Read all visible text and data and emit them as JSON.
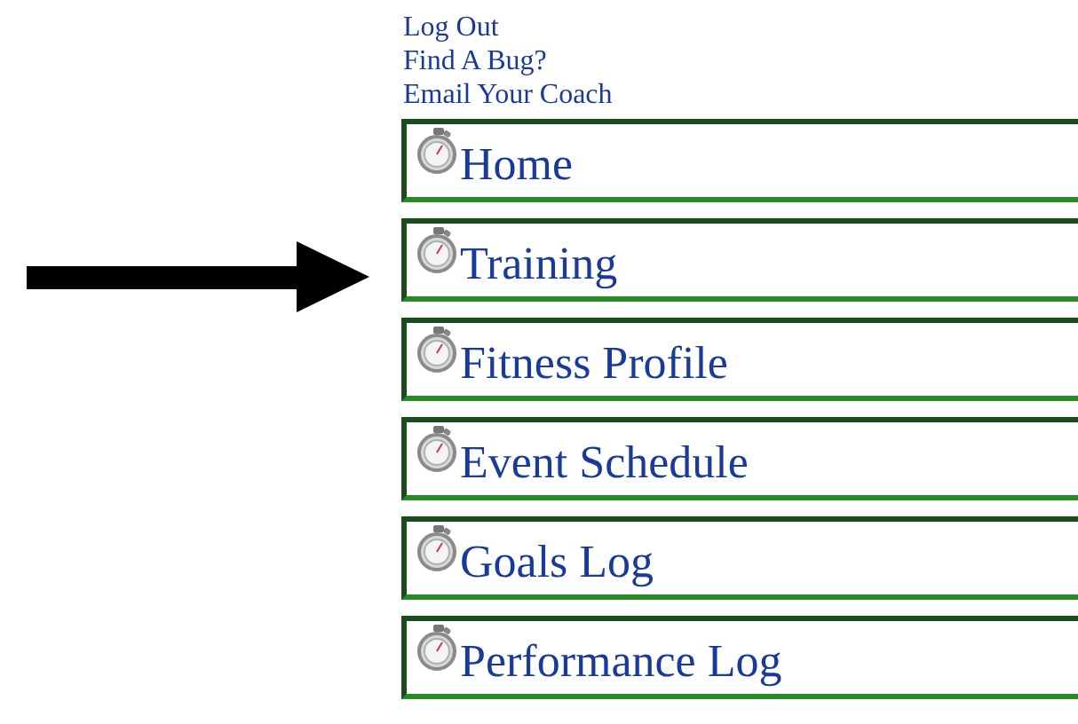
{
  "top_links": [
    "Log Out",
    "Find A Bug?",
    "Email Your Coach"
  ],
  "menu": [
    {
      "label": "Home"
    },
    {
      "label": "Training"
    },
    {
      "label": "Fitness Profile"
    },
    {
      "label": "Event Schedule"
    },
    {
      "label": "Goals Log"
    },
    {
      "label": "Performance Log"
    }
  ]
}
